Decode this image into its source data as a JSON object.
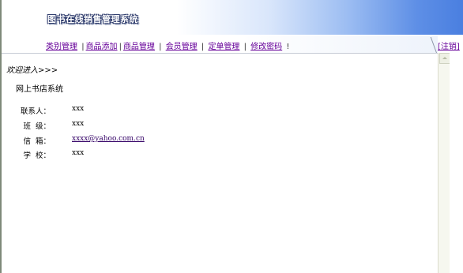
{
  "header": {
    "title": "图书在线销售管理系统"
  },
  "nav": {
    "items": [
      {
        "label": "类别管理"
      },
      {
        "label": "商品添加"
      },
      {
        "label": "商品管理"
      },
      {
        "label": "会员管理"
      },
      {
        "label": "定单管理"
      },
      {
        "label": "修改密码"
      }
    ],
    "separator": "|",
    "trailing": "!",
    "logout_label": "[注销]"
  },
  "main": {
    "welcome": "欢迎进入>>>",
    "system_name": "网上书店系统",
    "info": [
      {
        "label": "联系人：",
        "value": "xxx"
      },
      {
        "label": "班  级：",
        "value": "xxx"
      },
      {
        "label": "信  箱：",
        "value": "xxxx@yahoo.com.cn"
      },
      {
        "label": "学  校：",
        "value": "xxx"
      }
    ]
  }
}
